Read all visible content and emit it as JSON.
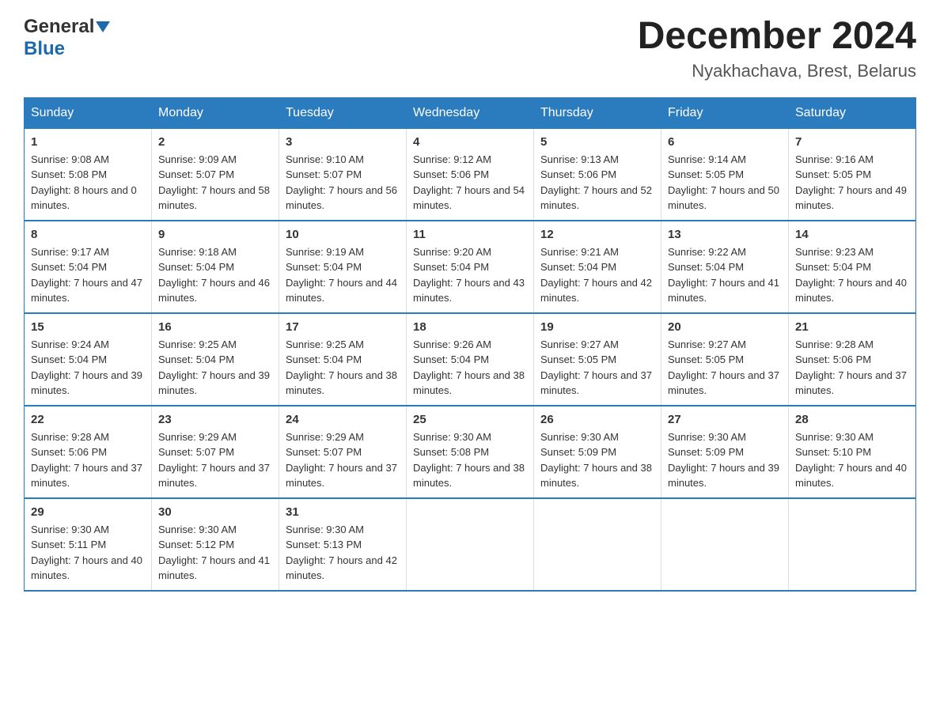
{
  "header": {
    "logo_general": "General",
    "logo_blue": "Blue",
    "month_year": "December 2024",
    "location": "Nyakhachava, Brest, Belarus"
  },
  "days_of_week": [
    "Sunday",
    "Monday",
    "Tuesday",
    "Wednesday",
    "Thursday",
    "Friday",
    "Saturday"
  ],
  "weeks": [
    [
      {
        "day": "1",
        "sunrise": "9:08 AM",
        "sunset": "5:08 PM",
        "daylight": "8 hours and 0 minutes."
      },
      {
        "day": "2",
        "sunrise": "9:09 AM",
        "sunset": "5:07 PM",
        "daylight": "7 hours and 58 minutes."
      },
      {
        "day": "3",
        "sunrise": "9:10 AM",
        "sunset": "5:07 PM",
        "daylight": "7 hours and 56 minutes."
      },
      {
        "day": "4",
        "sunrise": "9:12 AM",
        "sunset": "5:06 PM",
        "daylight": "7 hours and 54 minutes."
      },
      {
        "day": "5",
        "sunrise": "9:13 AM",
        "sunset": "5:06 PM",
        "daylight": "7 hours and 52 minutes."
      },
      {
        "day": "6",
        "sunrise": "9:14 AM",
        "sunset": "5:05 PM",
        "daylight": "7 hours and 50 minutes."
      },
      {
        "day": "7",
        "sunrise": "9:16 AM",
        "sunset": "5:05 PM",
        "daylight": "7 hours and 49 minutes."
      }
    ],
    [
      {
        "day": "8",
        "sunrise": "9:17 AM",
        "sunset": "5:04 PM",
        "daylight": "7 hours and 47 minutes."
      },
      {
        "day": "9",
        "sunrise": "9:18 AM",
        "sunset": "5:04 PM",
        "daylight": "7 hours and 46 minutes."
      },
      {
        "day": "10",
        "sunrise": "9:19 AM",
        "sunset": "5:04 PM",
        "daylight": "7 hours and 44 minutes."
      },
      {
        "day": "11",
        "sunrise": "9:20 AM",
        "sunset": "5:04 PM",
        "daylight": "7 hours and 43 minutes."
      },
      {
        "day": "12",
        "sunrise": "9:21 AM",
        "sunset": "5:04 PM",
        "daylight": "7 hours and 42 minutes."
      },
      {
        "day": "13",
        "sunrise": "9:22 AM",
        "sunset": "5:04 PM",
        "daylight": "7 hours and 41 minutes."
      },
      {
        "day": "14",
        "sunrise": "9:23 AM",
        "sunset": "5:04 PM",
        "daylight": "7 hours and 40 minutes."
      }
    ],
    [
      {
        "day": "15",
        "sunrise": "9:24 AM",
        "sunset": "5:04 PM",
        "daylight": "7 hours and 39 minutes."
      },
      {
        "day": "16",
        "sunrise": "9:25 AM",
        "sunset": "5:04 PM",
        "daylight": "7 hours and 39 minutes."
      },
      {
        "day": "17",
        "sunrise": "9:25 AM",
        "sunset": "5:04 PM",
        "daylight": "7 hours and 38 minutes."
      },
      {
        "day": "18",
        "sunrise": "9:26 AM",
        "sunset": "5:04 PM",
        "daylight": "7 hours and 38 minutes."
      },
      {
        "day": "19",
        "sunrise": "9:27 AM",
        "sunset": "5:05 PM",
        "daylight": "7 hours and 37 minutes."
      },
      {
        "day": "20",
        "sunrise": "9:27 AM",
        "sunset": "5:05 PM",
        "daylight": "7 hours and 37 minutes."
      },
      {
        "day": "21",
        "sunrise": "9:28 AM",
        "sunset": "5:06 PM",
        "daylight": "7 hours and 37 minutes."
      }
    ],
    [
      {
        "day": "22",
        "sunrise": "9:28 AM",
        "sunset": "5:06 PM",
        "daylight": "7 hours and 37 minutes."
      },
      {
        "day": "23",
        "sunrise": "9:29 AM",
        "sunset": "5:07 PM",
        "daylight": "7 hours and 37 minutes."
      },
      {
        "day": "24",
        "sunrise": "9:29 AM",
        "sunset": "5:07 PM",
        "daylight": "7 hours and 37 minutes."
      },
      {
        "day": "25",
        "sunrise": "9:30 AM",
        "sunset": "5:08 PM",
        "daylight": "7 hours and 38 minutes."
      },
      {
        "day": "26",
        "sunrise": "9:30 AM",
        "sunset": "5:09 PM",
        "daylight": "7 hours and 38 minutes."
      },
      {
        "day": "27",
        "sunrise": "9:30 AM",
        "sunset": "5:09 PM",
        "daylight": "7 hours and 39 minutes."
      },
      {
        "day": "28",
        "sunrise": "9:30 AM",
        "sunset": "5:10 PM",
        "daylight": "7 hours and 40 minutes."
      }
    ],
    [
      {
        "day": "29",
        "sunrise": "9:30 AM",
        "sunset": "5:11 PM",
        "daylight": "7 hours and 40 minutes."
      },
      {
        "day": "30",
        "sunrise": "9:30 AM",
        "sunset": "5:12 PM",
        "daylight": "7 hours and 41 minutes."
      },
      {
        "day": "31",
        "sunrise": "9:30 AM",
        "sunset": "5:13 PM",
        "daylight": "7 hours and 42 minutes."
      },
      null,
      null,
      null,
      null
    ]
  ],
  "labels": {
    "sunrise": "Sunrise:",
    "sunset": "Sunset:",
    "daylight": "Daylight:"
  }
}
